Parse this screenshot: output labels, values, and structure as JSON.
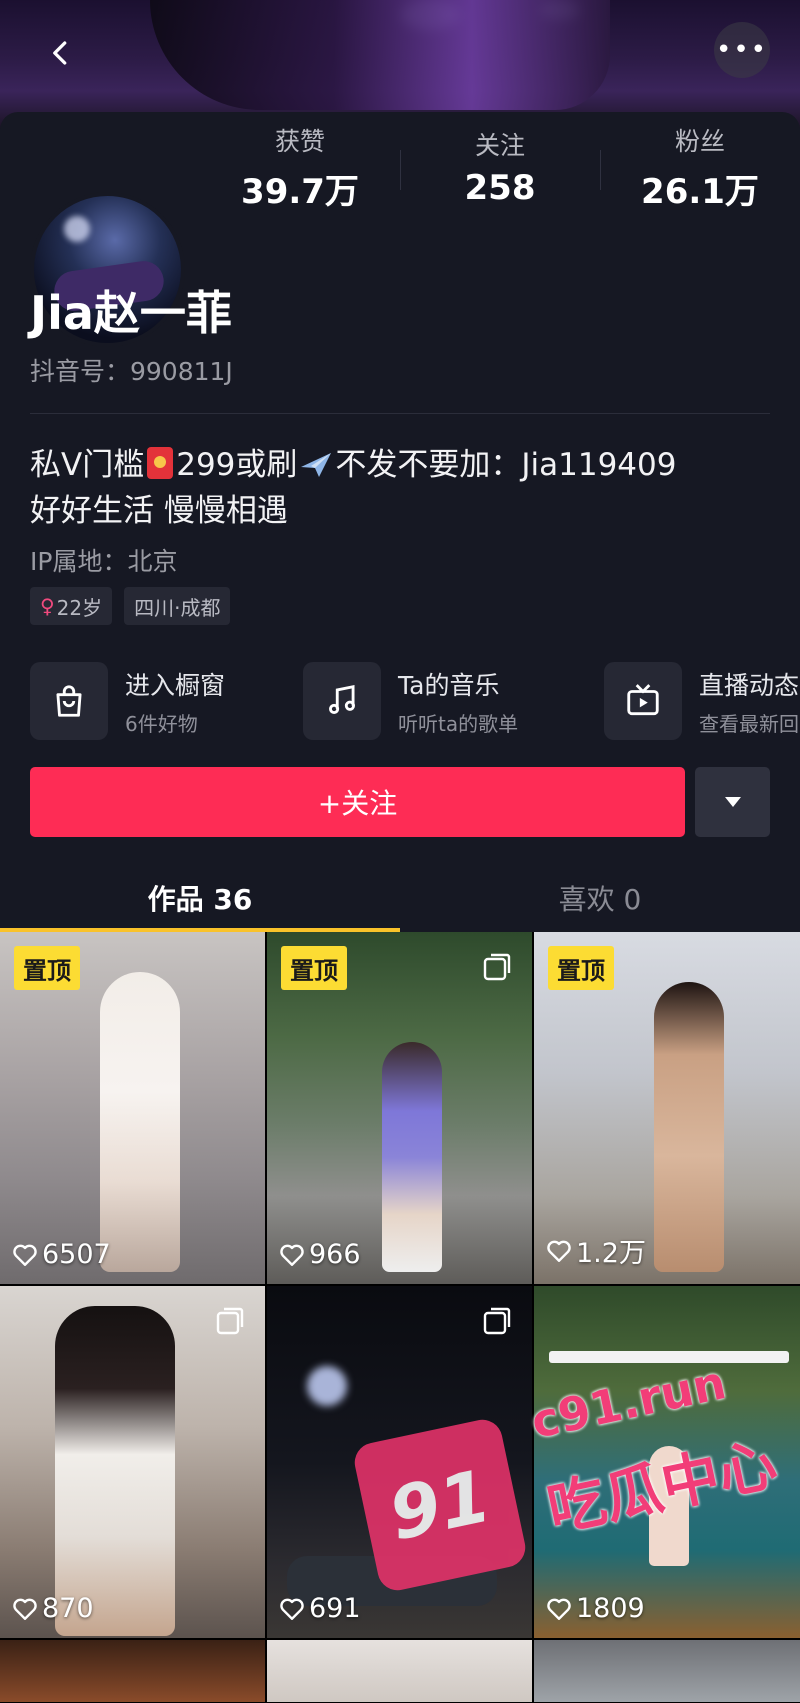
{
  "stats": [
    {
      "label": "获赞",
      "value": "39.7万"
    },
    {
      "label": "关注",
      "value": "258"
    },
    {
      "label": "粉丝",
      "value": "26.1万"
    }
  ],
  "profile": {
    "name": "Jia赵一菲",
    "douyin_id": "抖音号：990811J",
    "bio_part1": "私V门槛",
    "bio_part2": "299或刷",
    "bio_part3": "不发不要加：Jia119409",
    "bio_line2": "好好生活 慢慢相遇",
    "ip": "IP属地：北京",
    "tags": {
      "age": "22岁",
      "gender_symbol": "♀",
      "location": "四川·成都"
    }
  },
  "shortcuts": [
    {
      "title": "进入橱窗",
      "sub": "6件好物",
      "icon": "shopping-bag-icon"
    },
    {
      "title": "Ta的音乐",
      "sub": "听听ta的歌单",
      "icon": "music-note-icon"
    },
    {
      "title": "直播动态",
      "sub": "查看最新回",
      "icon": "tv-icon"
    }
  ],
  "actions": {
    "follow": "+关注"
  },
  "tabs": [
    {
      "label": "作品 36",
      "active": true
    },
    {
      "label": "喜欢 0",
      "active": false
    }
  ],
  "pin_label": "置顶",
  "videos": [
    {
      "likes": "6507",
      "pinned": true,
      "multi": false
    },
    {
      "likes": "966",
      "pinned": true,
      "multi": true
    },
    {
      "likes": "1.2万",
      "pinned": true,
      "multi": false
    },
    {
      "likes": "870",
      "pinned": false,
      "multi": true
    },
    {
      "likes": "691",
      "pinned": false,
      "multi": true
    },
    {
      "likes": "1809",
      "pinned": false,
      "multi": false
    }
  ],
  "watermark": {
    "badge": "91",
    "site": "c91.run",
    "text": "吃瓜中心"
  },
  "colors": {
    "background": "#161823",
    "accent": "#fe2c55",
    "pin": "#fcdc33",
    "tab_indicator": "#f9c22a"
  }
}
